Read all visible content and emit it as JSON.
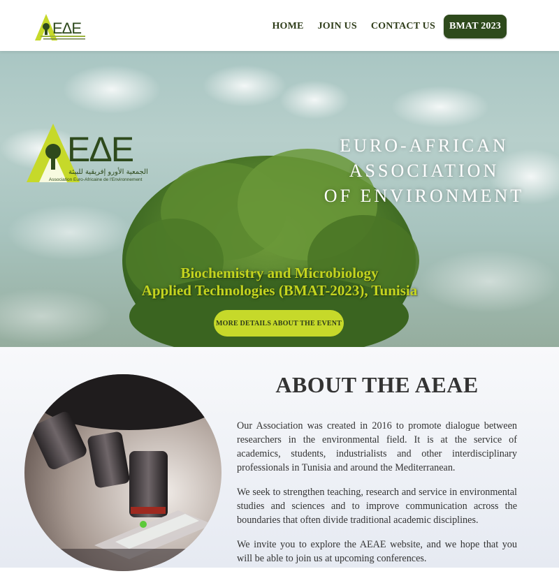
{
  "header": {
    "logo_text": "AEAE",
    "nav": {
      "home": "HOME",
      "join": "JOIN US",
      "contact": "CONTACT US",
      "cta": "BMAT 2023"
    }
  },
  "hero": {
    "logo_text": "AEAE",
    "logo_arabic": "الجمعية الأورو إفريقية للبيئة",
    "logo_caption": "Association Euro-Africaine de l'Environnement",
    "title_lines": [
      "EURO-AFRICAN",
      "ASSOCIATION",
      "OF ENVIRONMENT"
    ],
    "event_line1": "Biochemistry and Microbiology",
    "event_line2": "Applied Technologies (BMAT-2023), Tunisia",
    "event_button": "MORE DETAILS ABOUT THE EVENT"
  },
  "about": {
    "title": "ABOUT THE AEAE",
    "paragraphs": [
      "Our Association was created in 2016 to promote dialogue between researchers in the environmental field. It is at the service of academics, students, industrialists and other interdisciplinary professionals in Tunisia and around the Mediterranean.",
      "We seek to strengthen teaching, research and service in environmental studies and sciences and to improve communication across the boundaries that often divide traditional academic disciplines.",
      "We invite you to explore the AEAE website, and we hope that you will be able to join us at upcoming conferences."
    ]
  },
  "colors": {
    "brand_green_dark": "#2e4a1c",
    "brand_lime": "#c6d92a",
    "text_dark": "#333333"
  }
}
